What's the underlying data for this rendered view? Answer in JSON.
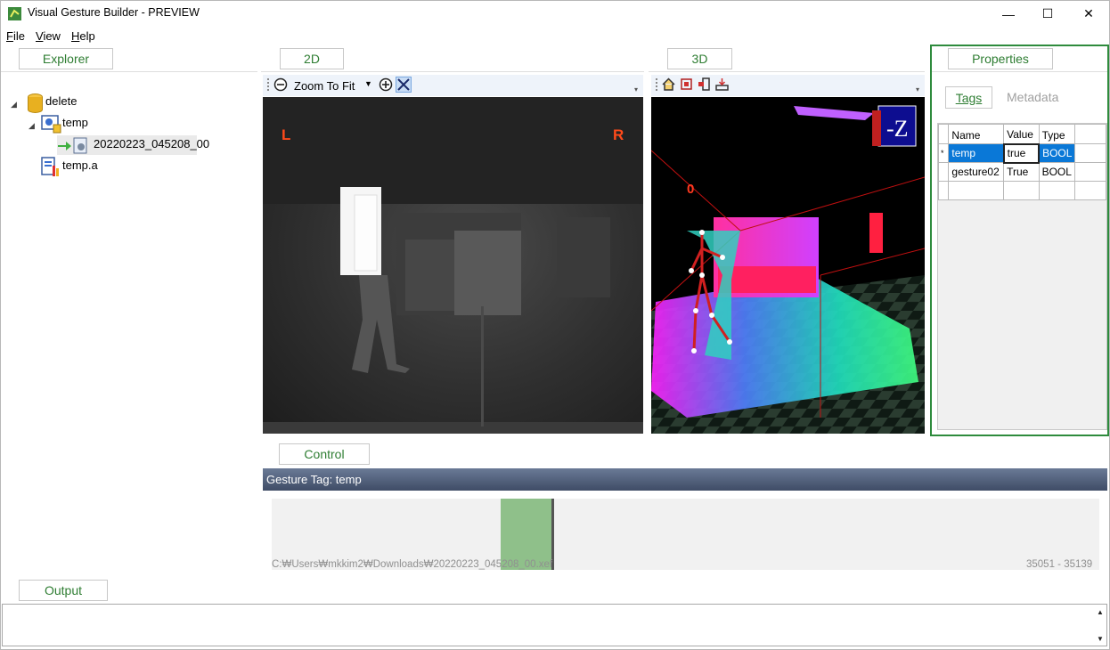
{
  "window": {
    "title": "Visual Gesture Builder - PREVIEW",
    "minimize_glyph": "—",
    "maximize_glyph": "☐",
    "close_glyph": "✕"
  },
  "menu": {
    "file": {
      "acc": "F",
      "rest": "ile"
    },
    "view": {
      "acc": "V",
      "rest": "iew"
    },
    "help": {
      "acc": "H",
      "rest": "elp"
    }
  },
  "explorer": {
    "tab_label": "Explorer",
    "tree": {
      "root": "delete",
      "project": "temp",
      "clip": "20220223_045208_00",
      "analysis": "temp.a"
    }
  },
  "view2d": {
    "tab_label": "2D",
    "zoom_label": "Zoom To Fit",
    "left_marker": "L",
    "right_marker": "R"
  },
  "view3d": {
    "tab_label": "3D",
    "axis_label": "-Z",
    "frame_label": "0"
  },
  "properties": {
    "tab_label": "Properties",
    "tabs": [
      "Tags",
      "Metadata"
    ],
    "columns": [
      "Name",
      "Value",
      "Type"
    ],
    "rows": [
      {
        "marker": "*",
        "name": "temp",
        "value": "true",
        "type": "BOOL"
      },
      {
        "marker": "",
        "name": "gesture02",
        "value": "True",
        "type": "BOOL"
      }
    ]
  },
  "control": {
    "tab_label": "Control",
    "gesture_tag": "Gesture Tag: temp",
    "file_path": "C:₩Users₩mkkim2₩Downloads₩20220223_045208_00.xef",
    "frame_range": "35051 - 35139"
  },
  "output": {
    "tab_label": "Output"
  },
  "colors": {
    "accent_green": "#2e7d32",
    "selection_blue": "#0a78d7",
    "gesture_bar": "#4a5872",
    "timeline_mark": "#8fc08a"
  }
}
